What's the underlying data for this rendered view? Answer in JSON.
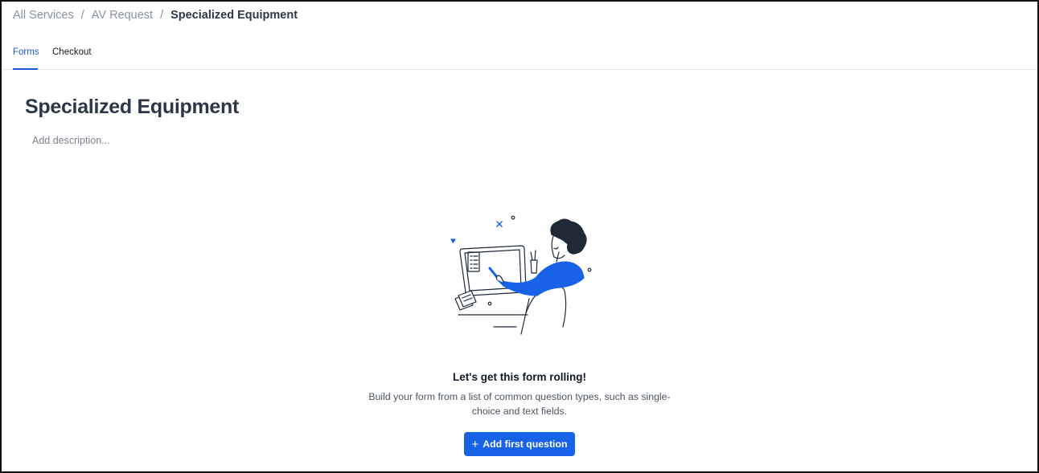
{
  "breadcrumb": {
    "items": [
      "All Services",
      "AV Request"
    ],
    "separator": "/",
    "current": "Specialized Equipment"
  },
  "tabs": [
    {
      "label": "Forms",
      "active": true
    },
    {
      "label": "Checkout",
      "active": false
    }
  ],
  "form": {
    "title": "Specialized Equipment",
    "description_placeholder": "Add description..."
  },
  "empty_state": {
    "illustration": "person-at-computer-illustration",
    "title": "Let's get this form rolling!",
    "text": "Build your form from a list of common question types, such as single-choice and text fields.",
    "button_label": "Add first question",
    "button_icon": "plus-icon"
  },
  "colors": {
    "accent": "#1d5bd6",
    "button": "#1762e6",
    "title": "#2d3748"
  }
}
